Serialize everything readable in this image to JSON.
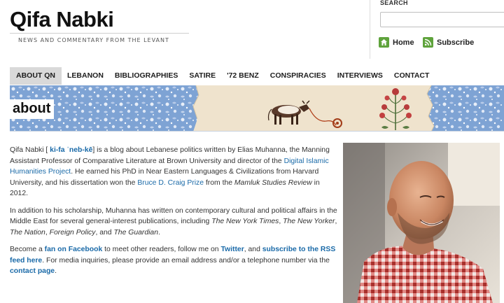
{
  "site": {
    "title": "Qifa Nabki",
    "tagline": "NEWS AND COMMENTARY FROM THE LEVANT"
  },
  "search": {
    "label": "SEARCH",
    "value": ""
  },
  "quick_links": {
    "home": "Home",
    "subscribe": "Subscribe"
  },
  "nav": {
    "items": [
      "ABOUT QN",
      "LEBANON",
      "BIBLIOGRAPHIES",
      "SATIRE",
      "'72 BENZ",
      "CONSPIRACIES",
      "INTERVIEWS",
      "CONTACT"
    ],
    "active": "ABOUT QN"
  },
  "banner": {
    "title": "about"
  },
  "content": {
    "p1": {
      "a": "Qifa Nabki [ ",
      "pron": "ki-fa ˈneb-kē",
      "b": "] is a blog about Lebanese politics written by Elias Muhanna, the Manning Assistant Professor of Comparative Literature at Brown University and director of the ",
      "link1": "Digital Islamic Humanities Project",
      "c": ". He earned his PhD in Near Eastern Languages & Civilizations from Harvard University, and his dissertation won the ",
      "link2": "Bruce D. Craig Prize",
      "d": " from the ",
      "journal": "Mamluk Studies Review",
      "e": " in 2012."
    },
    "p2": {
      "a": "In addition to his scholarship, Muhanna has written on contemporary cultural and political affairs in the Middle East for several general-interest publications, including ",
      "pub1": "The New York Times",
      "sep1": ", ",
      "pub2": "The New Yorker",
      "sep2": ", ",
      "pub3": "The Nation",
      "sep3": ", ",
      "pub4": "Foreign Policy",
      "sep4": ", and ",
      "pub5": "The Guardian",
      "end": "."
    },
    "p3": {
      "a": "Become a ",
      "link1": "fan on Facebook",
      "b": " to meet other readers, follow me on ",
      "link2": "Twitter",
      "c": ", and ",
      "link3": "subscribe to the RSS feed here",
      "d": ". For media inquiries, please provide an email address and/or a telephone number via the ",
      "link4": "contact page",
      "e": "."
    }
  },
  "colors": {
    "link": "#1a6aa8",
    "nav_active_bg": "#d9d9d9",
    "icon_green": "#5fa33c",
    "banner_blue": "#7da2d3"
  },
  "icons": {
    "home": "home-icon",
    "subscribe": "rss-icon"
  }
}
